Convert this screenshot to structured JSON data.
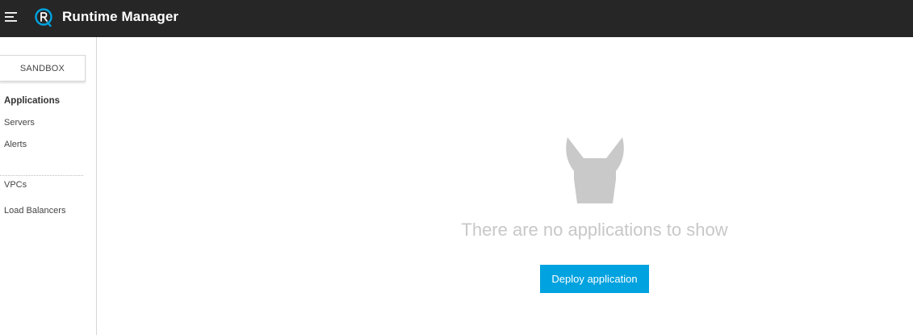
{
  "header": {
    "app_title": "Runtime Manager",
    "menu_icon": "hamburger-menu-icon",
    "logo_icon": "runtime-manager-logo-icon",
    "background_color": "#262626"
  },
  "sidebar": {
    "environment_label": "SANDBOX",
    "items": [
      {
        "label": "Applications",
        "active": true
      },
      {
        "label": "Servers",
        "active": false
      },
      {
        "label": "Alerts",
        "active": false
      },
      {
        "label": "VPCs",
        "active": false
      },
      {
        "label": "Load Balancers",
        "active": false
      }
    ]
  },
  "main": {
    "empty_icon": "mule-head-icon",
    "empty_message": "There are no applications to show",
    "deploy_button_label": "Deploy application",
    "accent_color": "#00a2df"
  }
}
